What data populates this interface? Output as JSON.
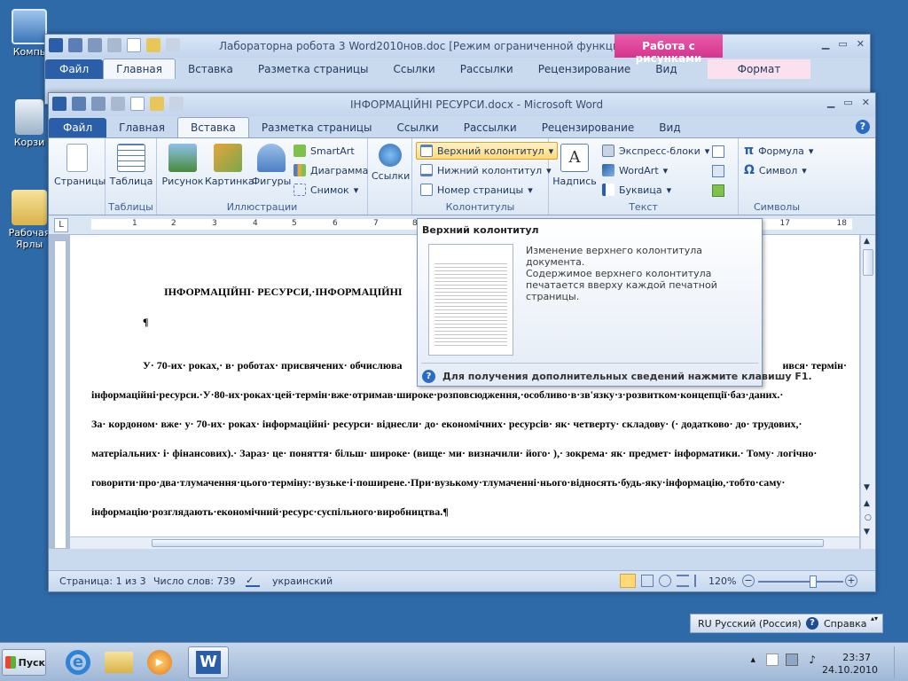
{
  "desktop": {
    "icons": [
      "Компь",
      "Корзи",
      "Рабочая Ярлы"
    ]
  },
  "back_window": {
    "title": "Лабораторна робота 3 Word2010нов.doc [Режим ограниченной функциональ...",
    "context_tab_group": "Работа с рисунками",
    "tabs": [
      "Файл",
      "Главная",
      "Вставка",
      "Разметка страницы",
      "Ссылки",
      "Рассылки",
      "Рецензирование",
      "Вид",
      "Формат"
    ]
  },
  "front_window": {
    "title": "ІНФОРМАЦІЙНІ РЕСУРСИ.docx - Microsoft Word",
    "tabs": [
      "Файл",
      "Главная",
      "Вставка",
      "Разметка страницы",
      "Ссылки",
      "Рассылки",
      "Рецензирование",
      "Вид"
    ],
    "ribbon": {
      "pages": "Страницы",
      "table": "Таблица",
      "tables_group": "Таблицы",
      "picture": "Рисунок",
      "clipart": "Картинка",
      "shapes": "Фигуры",
      "smartart": "SmartArt",
      "chart": "Диаграмма",
      "screenshot": "Снимок",
      "illustrations_group": "Иллюстрации",
      "links": "Ссылки",
      "header": "Верхний колонтитул",
      "footer": "Нижний колонтитул",
      "page_number": "Номер страницы",
      "headers_group": "Колонтитулы",
      "textbox": "Надпись",
      "quickparts": "Экспресс-блоки",
      "wordart": "WordArt",
      "dropcap": "Буквица",
      "text_group": "Текст",
      "equation": "Формула",
      "symbol": "Символ",
      "symbols_group": "Символы"
    },
    "ruler_numbers": [
      "1",
      "1",
      "2",
      "3",
      "4",
      "5",
      "6",
      "7",
      "8",
      "17",
      "18"
    ],
    "document": {
      "heading": "ІНФОРМАЦІЙНІ· РЕСУРСИ,·ІНФОРМАЦІЙНІ",
      "pilcrow": "¶",
      "lines": [
        "У· 70-их· роках,· в· роботах· присвячених· обчислюва",
        "ився· термін·",
        "інформаційні·ресурси.·У·80-их·роках·цей·термін·вже·отримав·широке·розповсюдження,·особливо·в·зв'язку·з·розвитком·концепції·баз·даних.·",
        "За· кордоном· вже· у· 70-их· роках· інформаційні· ресурси· віднесли· до· економічних· ресурсів· як· четверту· складову· (· додатково· до· трудових,·",
        "матеріальних· і· фінансових).· Зараз· це· поняття· більш· широке· (вище· ми· визначили· його· ),· зокрема· як· предмет· інформатики.· Тому· логічно·",
        "говорити·про·два·тлумачення·цього·терміну:·вузьке·і·поширене.·При·вузькому·тлумаченні·нього·відносять·будь-яку·інформацію,·тобто·саму·",
        "інформацію·розглядають·економічний·ресурс·суспільного·виробництва.¶"
      ]
    },
    "status": {
      "page": "Страница: 1 из 3",
      "words": "Число слов: 739",
      "language": "украинский",
      "zoom": "120%"
    }
  },
  "tooltip": {
    "title": "Верхний колонтитул",
    "line1": "Изменение верхнего колонтитула документа.",
    "line2": "Содержимое верхнего колонтитула печатается вверху каждой печатной страницы.",
    "help": "Для получения дополнительных сведений нажмите клавишу F1."
  },
  "taskbar": {
    "start": "Пуск",
    "lang": "RU Русский (Россия)",
    "help": "Справка",
    "time": "23:37",
    "date": "24.10.2010"
  },
  "colors": {
    "file_tab": "#2a5ea8",
    "context_tab": "#d6338f",
    "highlight": "#ffd978"
  }
}
